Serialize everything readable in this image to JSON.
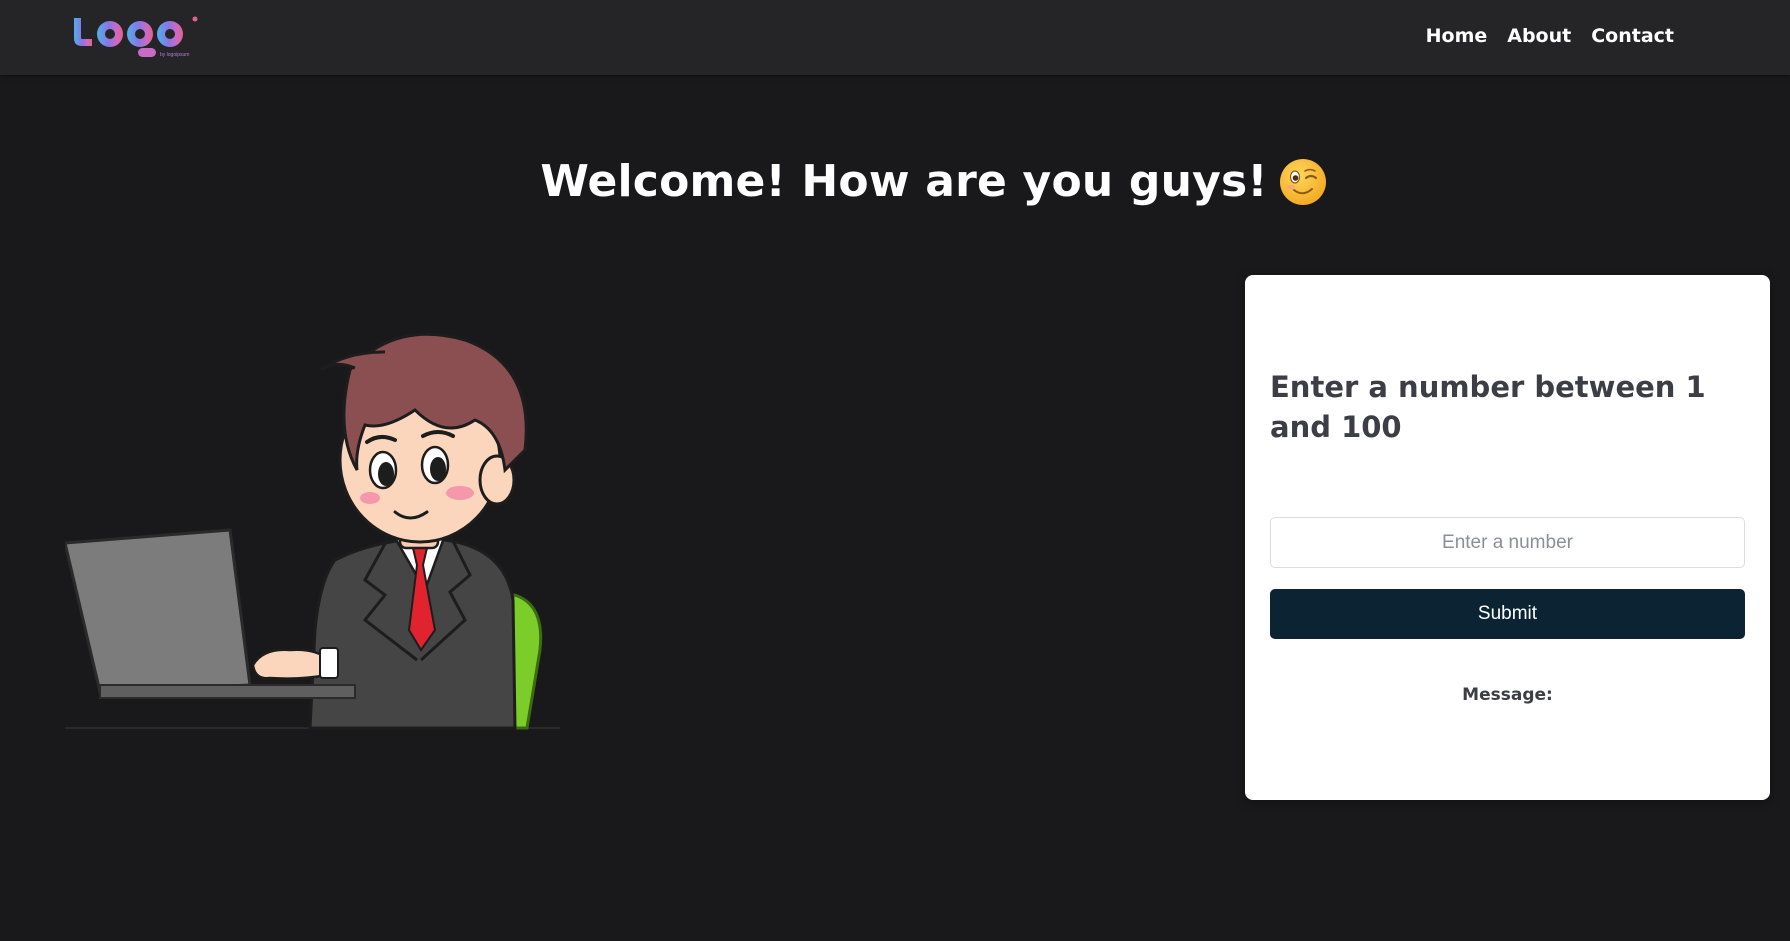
{
  "app": {
    "accent": "#0b2332",
    "background": "#19191b",
    "navbar_bg": "#252527"
  },
  "logo": {
    "name": "logo-icon",
    "tagline": "by logoipsum"
  },
  "nav": {
    "items": [
      {
        "label": "Home"
      },
      {
        "label": "About"
      },
      {
        "label": "Contact"
      }
    ]
  },
  "hero": {
    "title": "Welcome! How are you guys!",
    "emoji": "winking-face-icon"
  },
  "illustration": {
    "name": "man-at-laptop-illustration"
  },
  "form": {
    "title": "Enter a number between 1 and 100",
    "input_placeholder": "Enter a number",
    "input_value": "",
    "submit_label": "Submit",
    "message_label": "Message:"
  }
}
